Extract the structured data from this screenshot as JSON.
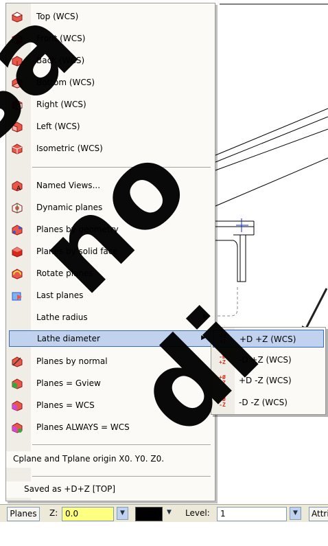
{
  "menu": {
    "items": [
      {
        "label": "Top (WCS)",
        "icon": "view-cube-top-icon"
      },
      {
        "label": "Front (WCS)",
        "icon": "view-cube-front-icon"
      },
      {
        "label": "Back (WCS)",
        "icon": "view-cube-back-icon"
      },
      {
        "label": "Bottom (WCS)",
        "icon": "view-cube-bottom-icon"
      },
      {
        "label": "Right (WCS)",
        "icon": "view-cube-right-icon"
      },
      {
        "label": "Left (WCS)",
        "icon": "view-cube-left-icon"
      },
      {
        "label": "Isometric (WCS)",
        "icon": "view-cube-isometric-icon"
      },
      {
        "label": "Named Views...",
        "icon": "named-views-icon"
      },
      {
        "label": "Dynamic planes",
        "icon": "dynamic-planes-icon"
      },
      {
        "label": "Planes by geometry",
        "icon": "planes-by-geometry-icon"
      },
      {
        "label": "Planes by solid face",
        "icon": "planes-by-solid-face-icon"
      },
      {
        "label": "Rotate planes",
        "icon": "rotate-planes-icon"
      },
      {
        "label": "Last planes",
        "icon": "last-planes-icon"
      },
      {
        "label": "Lathe radius",
        "icon": ""
      },
      {
        "label": "Lathe diameter",
        "icon": ""
      },
      {
        "label": "Planes by normal",
        "icon": "planes-by-normal-icon"
      },
      {
        "label": "Planes = Gview",
        "icon": "planes-gview-icon"
      },
      {
        "label": "Planes = WCS",
        "icon": "planes-wcs-icon"
      },
      {
        "label": "Planes ALWAYS = WCS",
        "icon": "planes-always-wcs-icon"
      },
      {
        "label": "Cplane and Tplane origin X0. Y0. Z0."
      },
      {
        "label": "Saved as +D+Z [TOP]"
      }
    ]
  },
  "submenu": {
    "items": [
      {
        "label": "+D +Z (WCS)",
        "icon": "plus-d-plus-z-icon"
      },
      {
        "label": "-D +Z (WCS)",
        "icon": "minus-d-plus-z-icon"
      },
      {
        "label": "+D -Z (WCS)",
        "icon": "plus-d-minus-z-icon"
      },
      {
        "label": "-D -Z (WCS)",
        "icon": "minus-d-minus-z-icon"
      }
    ]
  },
  "statusbar": {
    "planes_label": "Planes",
    "z_label": "Z:",
    "z_value": "0.0",
    "level_label": "Level:",
    "level_value": "1",
    "attr_label": "Attri"
  },
  "colors": {
    "highlight": "#c1d2ee",
    "highlight_border": "#316ac5",
    "z_field": "#ffff80",
    "icon_red": "#d9331f"
  }
}
